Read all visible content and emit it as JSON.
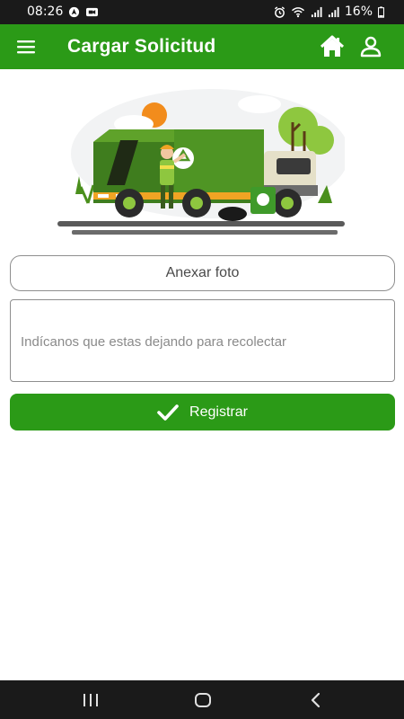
{
  "status_bar": {
    "time": "08:26",
    "battery": "16%",
    "icons": [
      "navigation-icon",
      "screen-record-icon",
      "alarm-icon",
      "wifi-icon",
      "signal-icon",
      "signal-icon",
      "battery-icon"
    ]
  },
  "app_bar": {
    "title": "Cargar Solicitud",
    "icons": [
      "menu-icon",
      "home-icon",
      "user-icon"
    ]
  },
  "form": {
    "attach_photo_label": "Anexar foto",
    "description_placeholder": "Indícanos que estas dejando para recolectar",
    "register_label": "Registrar",
    "register_icon": "check-icon"
  },
  "colors": {
    "primary_green": "#2b9a17",
    "system_bars": "#1a1a1a",
    "border": "#8e8e8e"
  },
  "nav_bar": {
    "icons": [
      "recents-icon",
      "home-circle-icon",
      "back-icon"
    ]
  }
}
